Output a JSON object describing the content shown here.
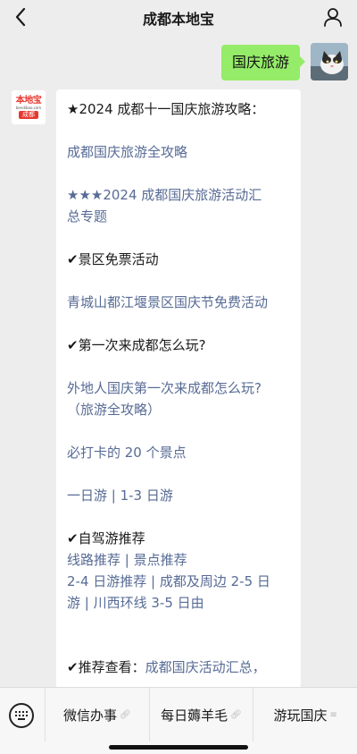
{
  "header": {
    "title": "成都本地宝",
    "back_icon": "chevron-left-icon",
    "profile_icon": "person-icon"
  },
  "outgoing": {
    "text": "国庆旅游"
  },
  "incoming": {
    "logo_top": "本地宝",
    "logo_url": "bendibao.com",
    "logo_city": "成都",
    "lines": [
      {
        "text": "★2024 成都十一国庆旅游攻略：",
        "kind": "text"
      },
      {
        "text": "成都国庆旅游全攻略",
        "kind": "link"
      },
      {
        "text": "★★★2024 成都国庆旅游活动汇",
        "kind": "link"
      },
      {
        "text": "总专题",
        "kind": "link"
      },
      {
        "text": "✔景区免票活动",
        "kind": "text"
      },
      {
        "text": "青城山都江堰景区国庆节免费活动",
        "kind": "link"
      },
      {
        "text": "✔第一次来成都怎么玩?",
        "kind": "text"
      },
      {
        "text": "外地人国庆第一次来成都怎么玩?",
        "kind": "link"
      },
      {
        "text": "（旅游全攻略）",
        "kind": "link"
      },
      {
        "text": "必打卡的 20 个景点",
        "kind": "link"
      },
      {
        "text": "一日游 | 1-3 日游",
        "kind": "link"
      },
      {
        "text": "✔自驾游推荐",
        "kind": "text"
      },
      {
        "text": "线路推荐 | 景点推荐",
        "kind": "link"
      },
      {
        "text": "2-4 日游推荐 | 成都及周边 2-5 日",
        "kind": "link"
      },
      {
        "text": "游 | 川西环线 3-5 日由",
        "kind": "link"
      },
      {
        "text": "✔推荐查看：",
        "kind": "text"
      },
      {
        "text": "成都国庆活动汇总，",
        "kind": "link"
      }
    ]
  },
  "bottom_menu": {
    "keyboard_icon": "keyboard-icon",
    "items": [
      {
        "label": "微信办事",
        "icon": "link-icon"
      },
      {
        "label": "每日薅羊毛",
        "icon": "link-icon"
      },
      {
        "label": "游玩国庆",
        "icon": "menu-icon"
      }
    ]
  }
}
